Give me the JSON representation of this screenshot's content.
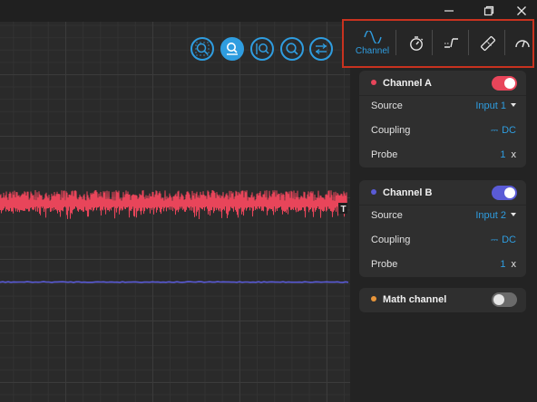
{
  "window": {
    "controls": [
      "minimize-icon",
      "restore-icon",
      "close-icon"
    ]
  },
  "zoom_tools": [
    "zoom-region-icon",
    "zoom-horizontal-icon",
    "zoom-vertical-icon",
    "zoom-icon",
    "adjust-icon"
  ],
  "toolbar": {
    "items": [
      {
        "icon": "sine-wave-icon",
        "label": "Channel",
        "active": true
      },
      {
        "icon": "stopwatch-icon",
        "label": "",
        "active": false
      },
      {
        "icon": "trigger-icon",
        "label": "",
        "active": false
      },
      {
        "icon": "ruler-icon",
        "label": "",
        "active": false
      },
      {
        "icon": "gauge-icon",
        "label": "",
        "active": false
      }
    ]
  },
  "plot": {
    "trigger_marker": "T",
    "channel_a_color": "#e8455a",
    "channel_b_color": "#5a5bd6"
  },
  "channel_a": {
    "name": "Channel A",
    "color": "#e8455a",
    "enabled": true,
    "source_label": "Source",
    "source_value": "Input 1",
    "coupling_label": "Coupling",
    "coupling_value": "DC",
    "probe_label": "Probe",
    "probe_value": "1",
    "probe_unit": "x"
  },
  "channel_b": {
    "name": "Channel B",
    "color": "#5a5bd6",
    "enabled": true,
    "source_label": "Source",
    "source_value": "Input 2",
    "coupling_label": "Coupling",
    "coupling_value": "DC",
    "probe_label": "Probe",
    "probe_value": "1",
    "probe_unit": "x"
  },
  "math_channel": {
    "name": "Math channel",
    "color": "#e8953a",
    "enabled": false
  }
}
